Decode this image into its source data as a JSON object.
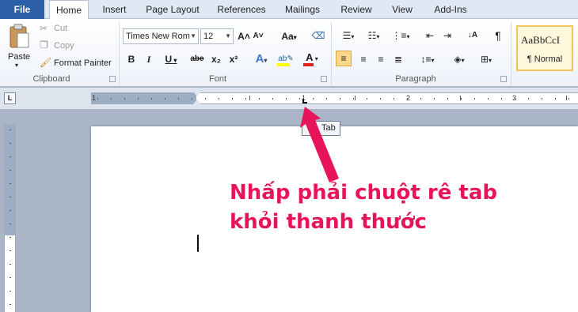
{
  "tabs": {
    "file": "File",
    "home": "Home",
    "insert": "Insert",
    "page_layout": "Page Layout",
    "references": "References",
    "mailings": "Mailings",
    "review": "Review",
    "view": "View",
    "add_ins": "Add-Ins"
  },
  "clipboard": {
    "paste": "Paste",
    "cut": "Cut",
    "copy": "Copy",
    "format_painter": "Format Painter",
    "label": "Clipboard"
  },
  "font": {
    "name": "Times New Rom",
    "size": "12",
    "label": "Font",
    "bold": "B",
    "italic": "I",
    "underline": "U",
    "strike": "abe",
    "subscript": "x₂",
    "superscript": "x²",
    "grow": "A˄",
    "shrink": "A˅",
    "change_case": "Aa"
  },
  "paragraph": {
    "label": "Paragraph",
    "pilcrow": "¶"
  },
  "styles": {
    "sample": "AaBbCcI",
    "name": "¶ Normal"
  },
  "ruler": {
    "numbers": [
      "1",
      "1",
      "2",
      "3"
    ],
    "selector": "L"
  },
  "tooltip": {
    "text": "Tab"
  },
  "annotation": {
    "line1": "Nhấp phải chuột rê tab",
    "line2": "khỏi thanh thước"
  },
  "colors": {
    "accent": "#2a5fa8",
    "annotation": "#e8145a",
    "highlight": "#ffff00",
    "font_color": "#e0201c"
  }
}
